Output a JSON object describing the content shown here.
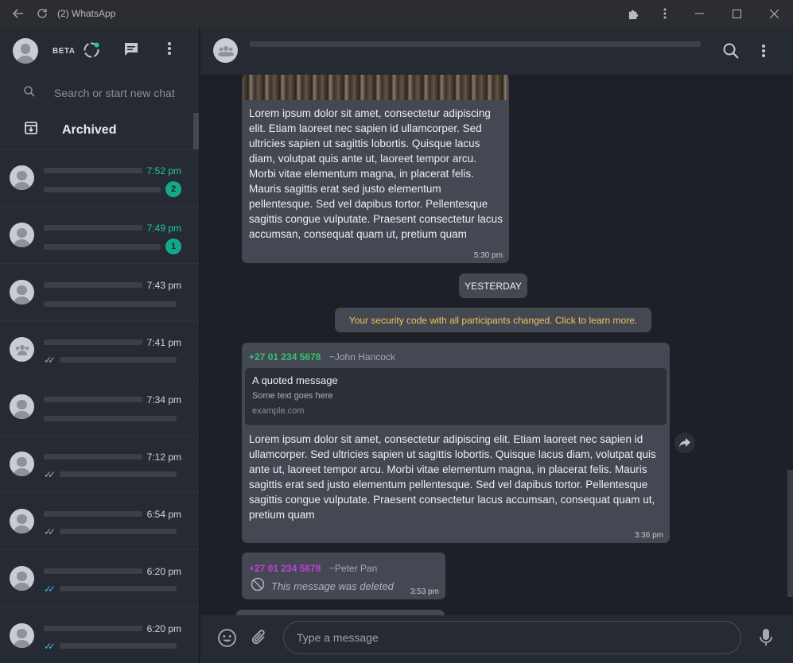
{
  "window": {
    "title": "(2) WhatsApp"
  },
  "sidebar": {
    "beta_label": "BETA",
    "search_placeholder": "Search or start new chat",
    "archived_label": "Archived",
    "chats": [
      {
        "time": "7:52 pm",
        "unread": "2",
        "ticks": ""
      },
      {
        "time": "7:49 pm",
        "unread": "1",
        "ticks": ""
      },
      {
        "time": "7:43 pm",
        "unread": "",
        "ticks": ""
      },
      {
        "time": "7:41 pm",
        "unread": "",
        "ticks": "grey"
      },
      {
        "time": "7:34 pm",
        "unread": "",
        "ticks": ""
      },
      {
        "time": "7:12 pm",
        "unread": "",
        "ticks": "grey"
      },
      {
        "time": "6:54 pm",
        "unread": "",
        "ticks": "grey"
      },
      {
        "time": "6:20 pm",
        "unread": "",
        "ticks": "blue"
      },
      {
        "time": "6:20 pm",
        "unread": "",
        "ticks": "blue"
      }
    ]
  },
  "conversation": {
    "messages": {
      "first": {
        "text": "Lorem ipsum dolor sit amet, consectetur adipiscing elit. Etiam laoreet nec sapien id ullamcorper. Sed ultricies sapien ut sagittis lobortis. Quisque lacus diam, volutpat quis ante ut, laoreet tempor arcu. Morbi vitae elementum magna, in placerat felis. Mauris sagittis erat sed justo elementum pellentesque. Sed vel dapibus tortor. Pellentesque sagittis congue vulputate. Praesent consectetur lacus accumsan, consequat quam ut, pretium quam",
        "time": "5:30 pm"
      },
      "date_divider": "YESTERDAY",
      "system_notice": "Your security code with all participants changed. Click to learn more.",
      "quoted": {
        "sender_phone": "+27 01 234 5678",
        "sender_name": "~John Hancock",
        "quote_title": "A quoted message",
        "quote_desc": "Some text goes here",
        "quote_url": "example.com",
        "text": "Lorem ipsum dolor sit amet, consectetur adipiscing elit. Etiam laoreet nec sapien id ullamcorper. Sed ultricies sapien ut sagittis lobortis. Quisque lacus diam, volutpat quis ante ut, laoreet tempor arcu. Morbi vitae elementum magna, in placerat felis. Mauris sagittis erat sed justo elementum pellentesque. Sed vel dapibus tortor. Pellentesque sagittis congue vulputate. Praesent consectetur lacus accumsan, consequat quam ut, pretium quam",
        "time": "3:36 pm"
      },
      "deleted": {
        "sender_phone": "+27 01 234 5678",
        "sender_name": "~Peter Pan",
        "text": "This message was deleted",
        "time": "3:53 pm"
      }
    },
    "composer_placeholder": "Type a message"
  },
  "colors": {
    "accent": "#21c8a4",
    "sender1": "#35c36b",
    "sender2": "#c43ee0",
    "notice": "#f0c35a",
    "tick_blue": "#3fb6f0"
  },
  "icons": [
    "back-arrow-icon",
    "reload-icon",
    "puzzle-icon",
    "kebab-menu-icon",
    "minimize-icon",
    "maximize-icon",
    "close-icon",
    "status-icon",
    "new-chat-icon",
    "search-icon",
    "archive-icon",
    "group-icon",
    "forward-icon",
    "emoji-icon",
    "attach-icon",
    "mic-icon",
    "deleted-icon"
  ]
}
